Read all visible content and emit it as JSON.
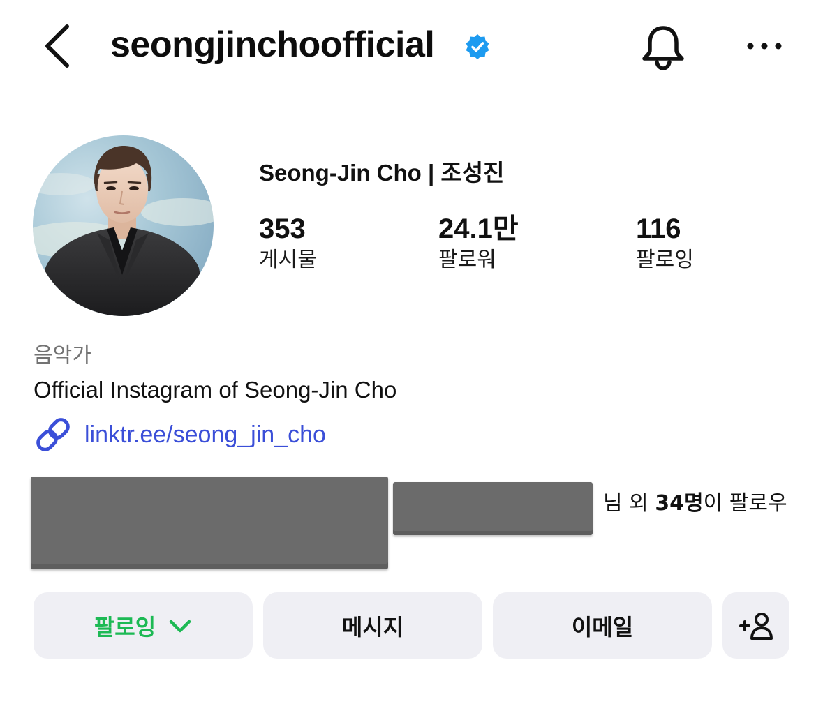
{
  "header": {
    "back_icon": "chevron-left-icon",
    "username": "seongjinchoofficial",
    "verified_icon": "verified-badge-icon",
    "verified_color": "#1d9bf0",
    "notification_icon": "bell-icon",
    "more_icon": "more-horizontal-icon"
  },
  "profile": {
    "avatar_icon": "avatar",
    "display_name": "Seong-Jin Cho | 조성진",
    "stats": {
      "posts": {
        "value": "353",
        "label": "게시물"
      },
      "followers": {
        "value": "24.1만",
        "label": "팔로워"
      },
      "following": {
        "value": "116",
        "label": "팔로잉"
      }
    }
  },
  "bio": {
    "category": "음악가",
    "text": "Official Instagram of Seong-Jin Cho",
    "link_icon": "link-icon",
    "link": "linktr.ee/seong_jin_cho",
    "link_color": "#3b4fd8"
  },
  "followed_by": {
    "suffix_prefix": "님 외 ",
    "count": "34명",
    "suffix_rest": "이 팔로우"
  },
  "actions": {
    "following_label": "팔로잉",
    "following_color": "#1db954",
    "message_label": "메시지",
    "email_label": "이메일",
    "add_user_icon": "add-user-icon"
  }
}
